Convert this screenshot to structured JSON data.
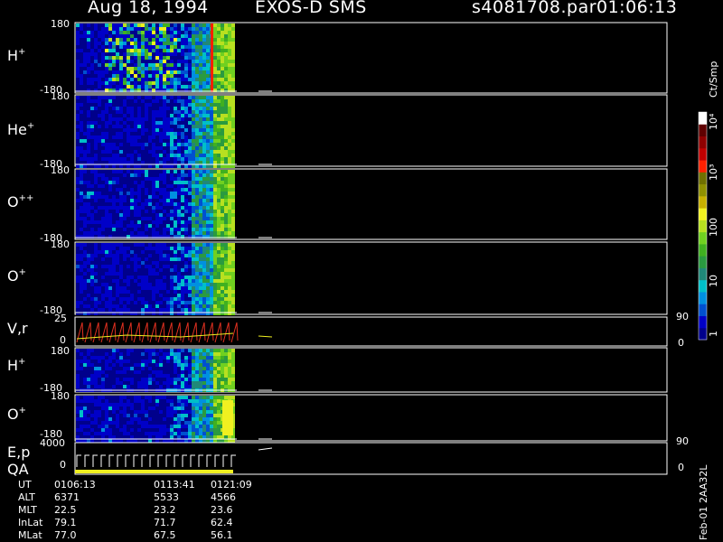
{
  "header": {
    "date": "Aug 18, 1994",
    "instrument": "EXOS-D SMS",
    "file": "s4081708.par",
    "time": "01:06:13"
  },
  "colorbar": {
    "unit_label": "Ct/Smp",
    "ticks": [
      "1",
      "10",
      "100",
      "10³",
      "10⁴"
    ],
    "colors": [
      "#00008b",
      "#0000c8",
      "#0050d0",
      "#0090e0",
      "#00c0c8",
      "#208878",
      "#2a9a40",
      "#40b020",
      "#70d020",
      "#b8e020",
      "#f0f020",
      "#c8b000",
      "#909000",
      "#707000",
      "#ff2000",
      "#c00000",
      "#900000",
      "#600000",
      "#ffffff"
    ]
  },
  "footer_note": "Feb-01 2AA32L",
  "ephemeris": {
    "rows": [
      {
        "label": "UT",
        "values": [
          "0106:13",
          "0113:41",
          "0121:09"
        ]
      },
      {
        "label": "ALT",
        "values": [
          "6371",
          "5533",
          "4566"
        ]
      },
      {
        "label": "MLT",
        "values": [
          "22.5",
          "23.2",
          "23.6"
        ]
      },
      {
        "label": "InLat",
        "values": [
          "79.1",
          "71.7",
          "62.4"
        ]
      },
      {
        "label": "MLat",
        "values": [
          "77.0",
          "67.5",
          "56.1"
        ]
      }
    ]
  },
  "chart_data": [
    {
      "type": "heatmap",
      "title": "H+",
      "ylabel": "H+",
      "ylim": [
        -180,
        180
      ],
      "yticks": [
        "180",
        "-180"
      ],
      "x": "UT"
    },
    {
      "type": "heatmap",
      "title": "He+",
      "ylabel": "He+",
      "ylim": [
        -180,
        180
      ],
      "yticks": [
        "180",
        "-180"
      ],
      "x": "UT"
    },
    {
      "type": "heatmap",
      "title": "O++",
      "ylabel": "O++",
      "ylim": [
        -180,
        180
      ],
      "yticks": [
        "180",
        "-180"
      ],
      "x": "UT"
    },
    {
      "type": "heatmap",
      "title": "O+",
      "ylabel": "O+",
      "ylim": [
        -180,
        180
      ],
      "yticks": [
        "180",
        "-180"
      ],
      "x": "UT"
    },
    {
      "type": "line",
      "title": "V,r",
      "ylabel": "V,r",
      "left_ticks": [
        "25",
        "0"
      ],
      "right_ticks": [
        "90",
        "0"
      ]
    },
    {
      "type": "heatmap",
      "title": "H+",
      "ylabel": "H+",
      "ylim": [
        -180,
        180
      ],
      "yticks": [
        "180",
        "-180"
      ],
      "x": "UT"
    },
    {
      "type": "heatmap",
      "title": "O+",
      "ylabel": "O+",
      "ylim": [
        -180,
        180
      ],
      "yticks": [
        "180",
        "-180"
      ],
      "x": "UT"
    },
    {
      "type": "line",
      "title": "E,p / QA",
      "ylabel": "E,p",
      "ylabel2": "QA",
      "left_ticks": [
        "4000",
        "0"
      ],
      "right_ticks": [
        "90",
        "0"
      ]
    }
  ]
}
